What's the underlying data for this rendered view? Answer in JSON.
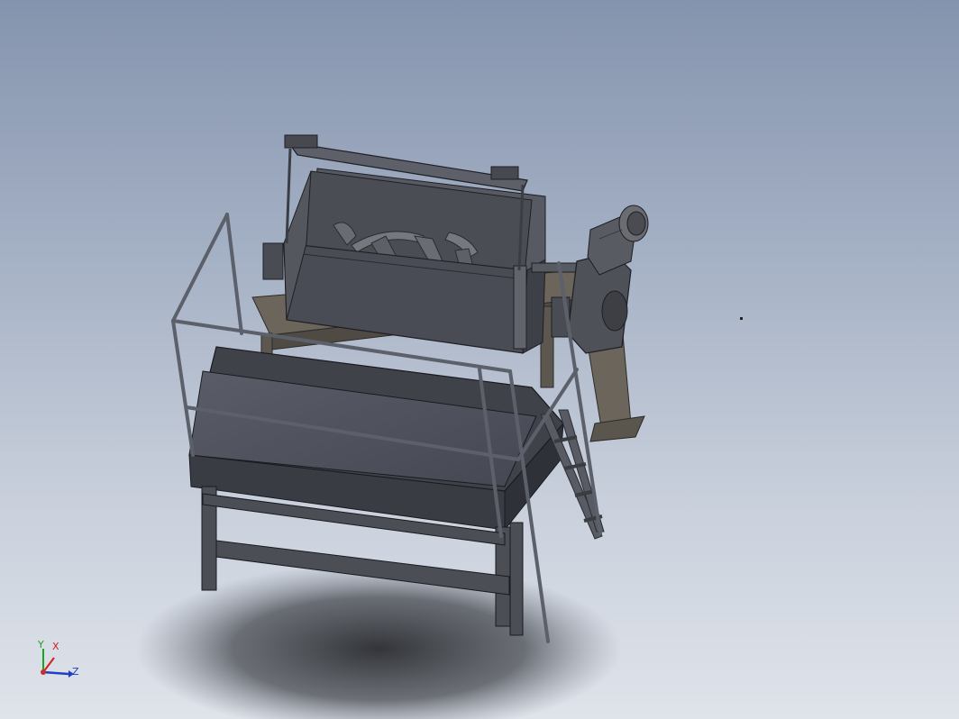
{
  "viewport": {
    "background_top": "#8594ae",
    "background_bottom": "#dfe3ea"
  },
  "model": {
    "description_icon": "ribbon-blender-assembly",
    "body_color": "#4a4c55",
    "frame_color": "#6b655c",
    "tray_color": "#3d3f48",
    "rail_color": "#5a5e69"
  },
  "triad": {
    "x_label": "X",
    "y_label": "Y",
    "z_label": "Z",
    "x_color": "#d42020",
    "y_color": "#17a51f",
    "z_color": "#1f3fc4"
  }
}
